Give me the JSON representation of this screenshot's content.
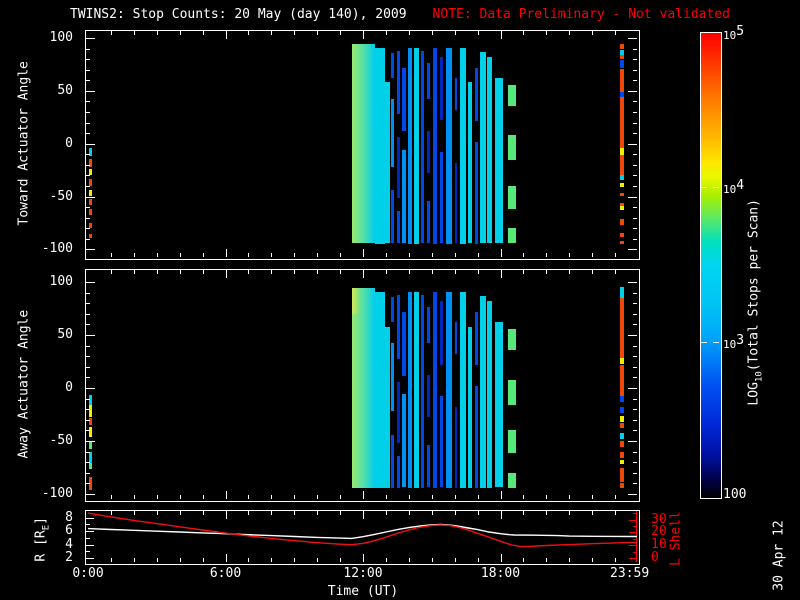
{
  "title": {
    "main": "TWINS2: Stop Counts: 20 May (day 140), 2009",
    "note": "NOTE: Data Preliminary - Not validated"
  },
  "labels": {
    "toward_y": "Toward Actuator Angle",
    "away_y": "Away Actuator Angle",
    "x_axis": "Time (UT)",
    "r_pre": "R [R",
    "r_sub": "E",
    "r_post": "]",
    "l_shell": "L Shell",
    "cb_pre": "LOG",
    "cb_sub": "10",
    "cb_post": "(Total Stops per Scan)",
    "date_stamp": "30 Apr 12"
  },
  "colors": {
    "background": "#000000",
    "foreground": "#FFFFFF",
    "note_red": "#FF0000",
    "axis_red": "#FF0000",
    "r_line": "#FFFFFF",
    "l_line": "#F01010"
  },
  "chart_data": {
    "type": "heatmap",
    "title": "TWINS2: Stop Counts: 20 May (day 140), 2009",
    "note": "NOTE: Data Preliminary - Not validated",
    "x_axis": {
      "label": "Time (UT)",
      "range_hours": [
        0,
        23.983
      ],
      "major_tick_hours": [
        0,
        6,
        12,
        18,
        23.983
      ],
      "tick_labels": [
        "0:00",
        "6:00",
        "12:00",
        "18:00",
        "23:59"
      ],
      "minor_tick_interval_hours": 1
    },
    "angle_axis": {
      "range_deg": [
        -107,
        107
      ],
      "major_ticks": [
        100,
        50,
        0,
        -50,
        -100
      ],
      "minor_tick_interval": 10
    },
    "orbit_axes": {
      "r_re": {
        "major_ticks": [
          8,
          6,
          4,
          2
        ],
        "minor_ticks": [
          7,
          5,
          3
        ]
      },
      "l_shell": {
        "major_ticks": [
          30,
          20,
          10,
          0
        ],
        "minor_ticks": [
          35,
          25,
          15,
          5
        ]
      }
    },
    "colorbar": {
      "tick_labels": [
        {
          "base": "10",
          "exp": "5"
        },
        {
          "base": "10",
          "exp": "4"
        },
        {
          "base": "10",
          "exp": "3"
        },
        {
          "base": "100",
          "exp": ""
        }
      ],
      "gradient_top_to_bottom": [
        "#FF0000 0%",
        "#FF3C00 7%",
        "#FF7800 14%",
        "#FFB400 22%",
        "#FFE800 28%",
        "#E8F800 31%",
        "#A8F000 35%",
        "#58E868 40%",
        "#00E0C0 45%",
        "#00D4F0 50%",
        "#00C4F4 58%",
        "#00A8F8 65%",
        "#0080F8 70%",
        "#0050F0 76%",
        "#0028D8 84%",
        "#0010A0 91%",
        "#000048 96%",
        "#000000 100%"
      ],
      "tick_fraction_top": [
        0.0,
        0.3333,
        0.6667,
        1.0
      ]
    },
    "palette": {
      "c": "#00D0E8",
      "b": "#0048E8",
      "lb": "#0090F4",
      "db": "#0028C0",
      "g": "#58E878",
      "y": "#F0F000",
      "o": "#F04808"
    },
    "spectrogram": {
      "stripes_common": [
        {
          "t0": 12.52,
          "t1": 12.96,
          "segs": [
            [
              91,
              -94,
              "c"
            ]
          ]
        },
        {
          "t0": 12.96,
          "t1": 13.18,
          "segs": [
            [
              58,
              -94,
              "c"
            ]
          ]
        },
        {
          "t0": 13.22,
          "t1": 13.35,
          "segs": [
            [
              86,
              62,
              "b"
            ],
            [
              42,
              -22,
              "lb"
            ],
            [
              -44,
              -94,
              "b"
            ]
          ]
        },
        {
          "t0": 13.48,
          "t1": 13.61,
          "segs": [
            [
              88,
              28,
              "b"
            ],
            [
              6,
              -52,
              "db"
            ],
            [
              -64,
              -94,
              "b"
            ]
          ]
        },
        {
          "t0": 13.7,
          "t1": 13.88,
          "segs": [
            [
              72,
              12,
              "b"
            ],
            [
              -6,
              -94,
              "lb"
            ]
          ]
        },
        {
          "t0": 13.96,
          "t1": 14.14,
          "segs": [
            [
              91,
              -94,
              "lb"
            ]
          ]
        },
        {
          "t0": 14.22,
          "t1": 14.44,
          "segs": [
            [
              91,
              -94,
              "c"
            ]
          ]
        },
        {
          "t0": 14.53,
          "t1": 14.66,
          "segs": [
            [
              88,
              -94,
              "b"
            ]
          ]
        },
        {
          "t0": 14.79,
          "t1": 14.92,
          "segs": [
            [
              76,
              42,
              "b"
            ],
            [
              12,
              -28,
              "db"
            ],
            [
              -54,
              -94,
              "b"
            ]
          ]
        },
        {
          "t0": 15.05,
          "t1": 15.23,
          "segs": [
            [
              91,
              -94,
              "b"
            ]
          ]
        },
        {
          "t0": 15.36,
          "t1": 15.49,
          "segs": [
            [
              82,
              22,
              "db"
            ],
            [
              -8,
              -94,
              "b"
            ]
          ]
        },
        {
          "t0": 15.62,
          "t1": 15.88,
          "segs": [
            [
              91,
              -94,
              "lb"
            ]
          ]
        },
        {
          "t0": 16.01,
          "t1": 16.1,
          "segs": [
            [
              62,
              32,
              "b"
            ],
            [
              -18,
              -94,
              "db"
            ]
          ]
        },
        {
          "t0": 16.23,
          "t1": 16.49,
          "segs": [
            [
              91,
              -94,
              "c"
            ]
          ]
        },
        {
          "t0": 16.58,
          "t1": 16.76,
          "segs": [
            [
              58,
              -94,
              "c"
            ]
          ]
        },
        {
          "t0": 16.89,
          "t1": 17.02,
          "segs": [
            [
              72,
              22,
              "b"
            ],
            [
              2,
              -94,
              "b"
            ]
          ]
        },
        {
          "t0": 17.1,
          "t1": 17.37,
          "segs": [
            [
              87,
              -94,
              "c"
            ]
          ]
        },
        {
          "t0": 17.41,
          "t1": 17.63,
          "segs": [
            [
              82,
              -94,
              "c"
            ]
          ]
        },
        {
          "t0": 17.76,
          "t1": 18.11,
          "segs": [
            [
              62,
              -94,
              "c"
            ]
          ]
        },
        {
          "t0": 18.33,
          "t1": 18.67,
          "segs": [
            [
              56,
              36,
              "g"
            ],
            [
              8,
              -16,
              "g"
            ],
            [
              -40,
              -62,
              "g"
            ],
            [
              -80,
              -94,
              "g"
            ]
          ]
        }
      ],
      "toward": {
        "blocks": [
          {
            "t0": 11.5,
            "t1": 12.52,
            "a": [
              94,
              -94
            ],
            "grad": [
              "#98E870",
              "#54E0A8",
              "#00CCF0"
            ]
          }
        ],
        "left_strip": {
          "t0": 0.04,
          "t1": 0.17,
          "segs": [
            [
              -4,
              -12,
              "c"
            ],
            [
              -14,
              -22,
              "o"
            ],
            [
              -24,
              -30,
              "y"
            ],
            [
              -33,
              -40,
              "o"
            ],
            [
              -44,
              -50,
              "y"
            ],
            [
              -52,
              -58,
              "o"
            ],
            [
              -62,
              -68,
              "o"
            ],
            [
              -75,
              -80,
              "o"
            ],
            [
              -85,
              -89,
              "o"
            ]
          ]
        },
        "right_stripe": {
          "t0": 23.21,
          "t1": 23.39,
          "segs": [
            [
              94,
              89,
              "o"
            ],
            [
              89,
              84,
              "c"
            ],
            [
              84,
              80,
              "o"
            ],
            [
              79,
              71,
              "b"
            ],
            [
              71,
              49,
              "o"
            ],
            [
              49,
              44,
              "b"
            ],
            [
              44,
              -4,
              "o"
            ],
            [
              -4,
              -11,
              "y"
            ],
            [
              -11,
              -30,
              "o"
            ],
            [
              -30,
              -35,
              "c"
            ],
            [
              -37,
              -41,
              "y"
            ],
            [
              -47,
              -50,
              "o"
            ],
            [
              -56,
              -59,
              "o"
            ],
            [
              -59,
              -63,
              "y"
            ],
            [
              -71,
              -77,
              "o"
            ],
            [
              -84,
              -88,
              "o"
            ],
            [
              -92,
              -95,
              "o"
            ]
          ]
        }
      },
      "away": {
        "blocks": [
          {
            "t0": 11.5,
            "t1": 12.52,
            "a": [
              94,
              -94
            ],
            "grad": [
              "#98E870",
              "#54E0A8",
              "#00CCF0"
            ]
          },
          {
            "t0": 11.5,
            "t1": 11.85,
            "a": [
              94,
              70
            ],
            "grad": [
              "#D0E858",
              "#A8E468",
              "#70E088"
            ]
          }
        ],
        "left_strip": {
          "t0": 0.04,
          "t1": 0.17,
          "segs": [
            [
              -7,
              -16,
              "c"
            ],
            [
              -16,
              -27,
              "y"
            ],
            [
              -28,
              -35,
              "o"
            ],
            [
              -37,
              -46,
              "y"
            ],
            [
              -50,
              -58,
              "g"
            ],
            [
              -60,
              -70,
              "c"
            ],
            [
              -71,
              -77,
              "g"
            ],
            [
              -84,
              -96,
              "o"
            ]
          ]
        },
        "right_stripe": {
          "t0": 23.21,
          "t1": 23.39,
          "segs": [
            [
              95,
              85,
              "c"
            ],
            [
              85,
              28,
              "o"
            ],
            [
              28,
              22,
              "y"
            ],
            [
              22,
              -8,
              "o"
            ],
            [
              -8,
              -14,
              "b"
            ],
            [
              -18,
              -24,
              "b"
            ],
            [
              -26,
              -32,
              "y"
            ],
            [
              -33,
              -38,
              "o"
            ],
            [
              -42,
              -48,
              "c"
            ],
            [
              -50,
              -56,
              "o"
            ],
            [
              -60,
              -66,
              "o"
            ],
            [
              -68,
              -72,
              "y"
            ],
            [
              -75,
              -88,
              "o"
            ],
            [
              -90,
              -95,
              "o"
            ]
          ]
        }
      }
    },
    "series": {
      "r_re": {
        "name": "R [RE]",
        "color": "#FFFFFF",
        "points": [
          [
            0,
            6.35
          ],
          [
            1,
            6.22
          ],
          [
            2,
            6.1
          ],
          [
            3,
            5.97
          ],
          [
            4,
            5.85
          ],
          [
            5,
            5.72
          ],
          [
            6,
            5.6
          ],
          [
            7,
            5.45
          ],
          [
            8,
            5.32
          ],
          [
            9,
            5.18
          ],
          [
            10,
            5.05
          ],
          [
            11,
            4.95
          ],
          [
            11.5,
            4.9
          ],
          [
            12,
            5.15
          ],
          [
            12.5,
            5.5
          ],
          [
            13,
            5.85
          ],
          [
            13.5,
            6.2
          ],
          [
            14,
            6.5
          ],
          [
            14.5,
            6.75
          ],
          [
            15,
            6.92
          ],
          [
            15.4,
            6.97
          ],
          [
            15.8,
            6.88
          ],
          [
            16.2,
            6.7
          ],
          [
            16.6,
            6.45
          ],
          [
            17,
            6.2
          ],
          [
            17.5,
            5.85
          ],
          [
            18,
            5.6
          ],
          [
            18.4,
            5.45
          ],
          [
            18.6,
            5.4
          ],
          [
            19.5,
            5.38
          ],
          [
            20.5,
            5.32
          ],
          [
            21,
            5.25
          ],
          [
            22,
            5.22
          ],
          [
            23,
            5.2
          ],
          [
            23.98,
            5.18
          ]
        ]
      },
      "l_shell": {
        "name": "L Shell",
        "color": "#F01010",
        "points": [
          [
            0,
            35
          ],
          [
            1,
            32
          ],
          [
            2,
            29.3
          ],
          [
            3,
            26.8
          ],
          [
            4,
            24.3
          ],
          [
            5,
            21.8
          ],
          [
            6,
            19.4
          ],
          [
            7,
            17.2
          ],
          [
            8,
            15.2
          ],
          [
            9,
            13.4
          ],
          [
            10,
            11.9
          ],
          [
            11,
            10.7
          ],
          [
            11.5,
            10.3
          ],
          [
            12,
            11.3
          ],
          [
            12.5,
            13.4
          ],
          [
            13,
            16.2
          ],
          [
            13.5,
            19.2
          ],
          [
            14,
            21.9
          ],
          [
            14.5,
            24.0
          ],
          [
            15,
            25.3
          ],
          [
            15.4,
            25.7
          ],
          [
            15.8,
            25.2
          ],
          [
            16.2,
            23.8
          ],
          [
            16.6,
            21.7
          ],
          [
            17,
            19.2
          ],
          [
            17.5,
            16.2
          ],
          [
            18,
            13.0
          ],
          [
            18.5,
            10.0
          ],
          [
            18.9,
            8.8
          ],
          [
            19.2,
            9.0
          ],
          [
            20,
            9.7
          ],
          [
            21,
            10.4
          ],
          [
            22,
            11.1
          ],
          [
            23,
            11.7
          ],
          [
            23.98,
            12.2
          ]
        ]
      }
    }
  }
}
